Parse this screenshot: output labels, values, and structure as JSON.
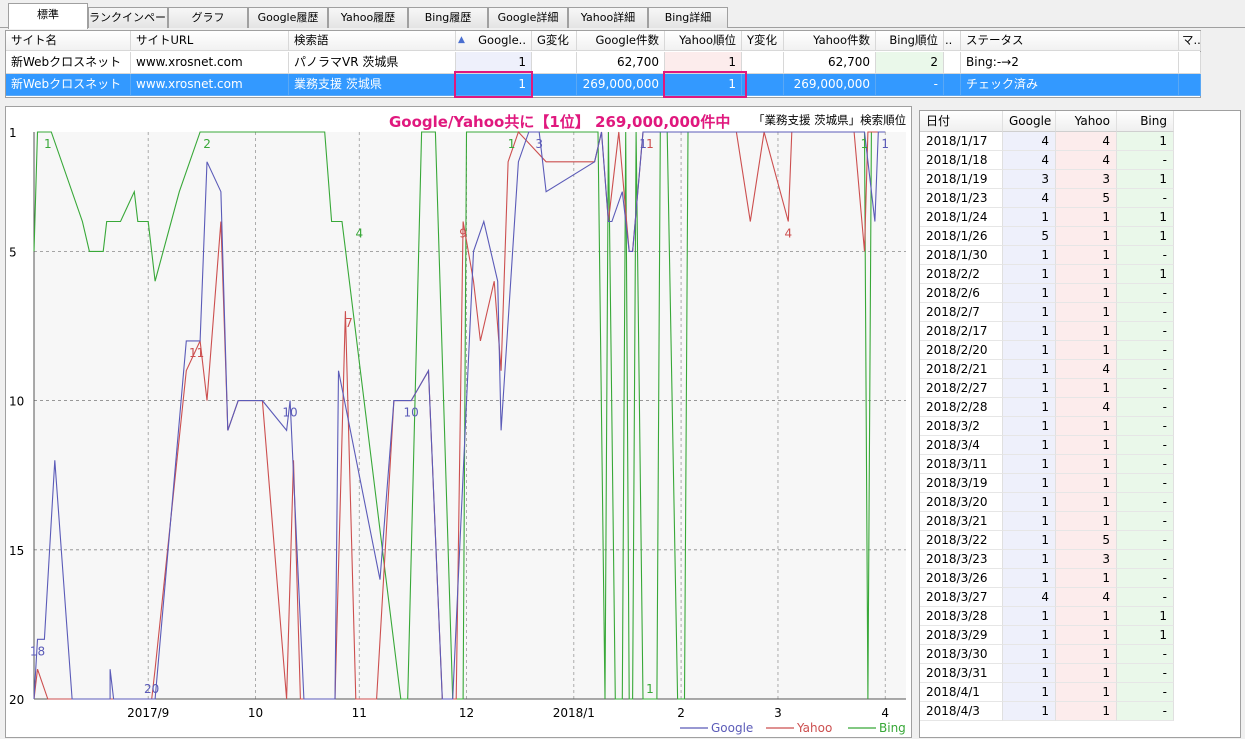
{
  "tabs": [
    "標準",
    "ランクインページ",
    "グラフ",
    "Google履歴",
    "Yahoo履歴",
    "Bing履歴",
    "Google詳細",
    "Yahoo詳細",
    "Bing詳細"
  ],
  "grid": {
    "headers": [
      "サイト名",
      "サイトURL",
      "検索語",
      "Google..",
      "G変化",
      "Google件数",
      "Yahoo順位",
      "Y変化",
      "Yahoo件数",
      "Bing順位",
      "..",
      "ステータス",
      "マ.."
    ],
    "rows": [
      {
        "site": "新Webクロスネット",
        "url": "www.xrosnet.com",
        "keyword": "パノラマVR 茨城県",
        "google": "1",
        "gchange": "",
        "gcount": "62,700",
        "yahoo": "1",
        "ychange": "",
        "ycount": "62,700",
        "bing": "2",
        "x": "",
        "status": "Bing:-→2",
        "m": ""
      },
      {
        "site": "新Webクロスネット",
        "url": "www.xrosnet.com",
        "keyword": "業務支援 茨城県",
        "google": "1",
        "gchange": "",
        "gcount": "269,000,000",
        "yahoo": "1",
        "ychange": "",
        "ycount": "269,000,000",
        "bing": "-",
        "x": "",
        "status": "チェック済み",
        "m": ""
      }
    ]
  },
  "chart": {
    "headline": "Google/Yahoo共に【1位】 269,000,000件中",
    "subtitle": "「業務支援 茨城県」検索順位",
    "headline_color": "#e0187e",
    "colors": {
      "google": "#5b5bb8",
      "yahoo": "#cc4f4f",
      "bing": "#38a838"
    }
  },
  "chart_data": {
    "type": "line",
    "title": "「業務支援 茨城県」検索順位",
    "y_ticks": [
      "1",
      "5",
      "10",
      "15",
      "20"
    ],
    "ylim": [
      20,
      1
    ],
    "y_inverted": true,
    "x_ticks": [
      "2017/9",
      "10",
      "11",
      "12",
      "2018/1",
      "2",
      "3",
      "4"
    ],
    "x_tick_days": [
      33,
      64,
      94,
      125,
      156,
      187,
      215,
      246
    ],
    "xlim": [
      0,
      252
    ],
    "grid": true,
    "legend_position": "bottom-right",
    "legend": [
      "Google",
      "Yahoo",
      "Bing"
    ],
    "series": [
      {
        "name": "Google",
        "points": [
          [
            0,
            20
          ],
          [
            1,
            18
          ],
          [
            3,
            18
          ],
          [
            6,
            12
          ],
          [
            11,
            20
          ],
          [
            22,
            20
          ],
          [
            22,
            19
          ],
          [
            23,
            20
          ],
          [
            34,
            20
          ],
          [
            35,
            20
          ],
          [
            44,
            8
          ],
          [
            48,
            8
          ],
          [
            50,
            2
          ],
          [
            54,
            3
          ],
          [
            56,
            11
          ],
          [
            59,
            10
          ],
          [
            66,
            10
          ],
          [
            73,
            11
          ],
          [
            74,
            10
          ],
          [
            78,
            20
          ],
          [
            87,
            20
          ],
          [
            88,
            9
          ],
          [
            100,
            16
          ],
          [
            104,
            10
          ],
          [
            109,
            10
          ],
          [
            114,
            9
          ],
          [
            118,
            20
          ],
          [
            121,
            20
          ],
          [
            127,
            5
          ],
          [
            130,
            4
          ],
          [
            134,
            6
          ],
          [
            135,
            11
          ],
          [
            140,
            2
          ],
          [
            143,
            1
          ],
          [
            146,
            1
          ],
          [
            148,
            3
          ],
          [
            162,
            2
          ],
          [
            164,
            1
          ],
          [
            166,
            4
          ],
          [
            167,
            4
          ],
          [
            170,
            3
          ],
          [
            172,
            5
          ],
          [
            173,
            5
          ],
          [
            176,
            1
          ],
          [
            180,
            1
          ],
          [
            183,
            1
          ],
          [
            186,
            1
          ],
          [
            194,
            1
          ],
          [
            203,
            1
          ],
          [
            211,
            1
          ],
          [
            219,
            1
          ],
          [
            225,
            1
          ],
          [
            237,
            1
          ],
          [
            240,
            1
          ],
          [
            243,
            4
          ],
          [
            244,
            1
          ],
          [
            246,
            1
          ]
        ],
        "labels": [
          [
            1,
            "18"
          ],
          [
            34,
            "20"
          ],
          [
            74,
            "10"
          ],
          [
            109,
            "10"
          ],
          [
            146,
            "3"
          ],
          [
            176,
            "1"
          ],
          [
            246,
            "1"
          ]
        ]
      },
      {
        "name": "Yahoo",
        "points": [
          [
            0,
            20
          ],
          [
            1,
            19
          ],
          [
            4,
            20
          ],
          [
            9,
            20
          ],
          [
            12,
            20
          ],
          [
            34,
            20
          ],
          [
            35,
            19
          ],
          [
            44,
            9
          ],
          [
            48,
            8
          ],
          [
            50,
            10
          ],
          [
            54,
            4
          ],
          [
            56,
            11
          ],
          [
            59,
            10
          ],
          [
            66,
            10
          ],
          [
            73,
            20
          ],
          [
            75,
            12
          ],
          [
            77,
            20
          ],
          [
            87,
            20
          ],
          [
            90,
            7
          ],
          [
            93,
            20
          ],
          [
            99,
            20
          ],
          [
            104,
            10
          ],
          [
            109,
            10
          ],
          [
            114,
            9
          ],
          [
            118,
            20
          ],
          [
            122,
            20
          ],
          [
            124,
            4
          ],
          [
            127,
            6
          ],
          [
            129,
            8
          ],
          [
            133,
            6
          ],
          [
            135,
            9
          ],
          [
            137,
            2
          ],
          [
            140,
            1
          ],
          [
            148,
            2
          ],
          [
            162,
            2
          ],
          [
            164,
            1
          ],
          [
            166,
            4
          ],
          [
            169,
            1
          ],
          [
            172,
            5
          ],
          [
            173,
            5
          ],
          [
            176,
            1
          ],
          [
            180,
            1
          ],
          [
            183,
            1
          ],
          [
            194,
            1
          ],
          [
            203,
            1
          ],
          [
            207,
            4
          ],
          [
            211,
            1
          ],
          [
            218,
            4
          ],
          [
            219,
            1
          ],
          [
            225,
            1
          ],
          [
            237,
            1
          ],
          [
            240,
            5
          ],
          [
            241,
            1
          ],
          [
            243,
            1
          ],
          [
            246,
            1
          ]
        ],
        "labels": [
          [
            47,
            "11"
          ],
          [
            91,
            "7"
          ],
          [
            124,
            "9"
          ],
          [
            178,
            "1"
          ],
          [
            218,
            "4"
          ]
        ]
      },
      {
        "name": "Bing",
        "points": [
          [
            0,
            5
          ],
          [
            1,
            1
          ],
          [
            5,
            1
          ],
          [
            14,
            4
          ],
          [
            16,
            5
          ],
          [
            20,
            5
          ],
          [
            21,
            4
          ],
          [
            25,
            4
          ],
          [
            29,
            3
          ],
          [
            30,
            4
          ],
          [
            33,
            4
          ],
          [
            35,
            6
          ],
          [
            42,
            3
          ],
          [
            48,
            1
          ],
          [
            50,
            1
          ],
          [
            53,
            1
          ],
          [
            84,
            1
          ],
          [
            86,
            4
          ],
          [
            89,
            4
          ],
          [
            106,
            20
          ],
          [
            108,
            20
          ],
          [
            112,
            1
          ],
          [
            116,
            1
          ],
          [
            121,
            20
          ],
          [
            124,
            20
          ],
          [
            125,
            1
          ],
          [
            129,
            1
          ],
          [
            141,
            1
          ],
          [
            148,
            1
          ],
          [
            163,
            1
          ],
          [
            165,
            20
          ],
          [
            166,
            1
          ],
          [
            168,
            20
          ],
          [
            170,
            20
          ],
          [
            171,
            1
          ],
          [
            172,
            20
          ],
          [
            173,
            20
          ],
          [
            174,
            1
          ],
          [
            176,
            20
          ],
          [
            180,
            20
          ],
          [
            181,
            1
          ],
          [
            183,
            1
          ],
          [
            186,
            20
          ],
          [
            188,
            20
          ],
          [
            189,
            1
          ],
          [
            193,
            1
          ],
          [
            219,
            1
          ],
          [
            236,
            1
          ],
          [
            240,
            1
          ],
          [
            241,
            20
          ],
          [
            242,
            1
          ],
          [
            246,
            1
          ]
        ],
        "labels": [
          [
            4,
            "1"
          ],
          [
            50,
            "2"
          ],
          [
            94,
            "4"
          ],
          [
            138,
            "1"
          ],
          [
            178,
            "1"
          ],
          [
            240,
            "1"
          ]
        ]
      }
    ]
  },
  "history": {
    "headers": [
      "日付",
      "Google",
      "Yahoo",
      "Bing"
    ],
    "rows": [
      [
        "2018/1/17",
        "4",
        "4",
        "1"
      ],
      [
        "2018/1/18",
        "4",
        "4",
        "-"
      ],
      [
        "2018/1/19",
        "3",
        "3",
        "1"
      ],
      [
        "2018/1/23",
        "4",
        "5",
        "-"
      ],
      [
        "2018/1/24",
        "1",
        "1",
        "1"
      ],
      [
        "2018/1/26",
        "5",
        "1",
        "1"
      ],
      [
        "2018/1/30",
        "1",
        "1",
        "-"
      ],
      [
        "2018/2/2",
        "1",
        "1",
        "1"
      ],
      [
        "2018/2/6",
        "1",
        "1",
        "-"
      ],
      [
        "2018/2/7",
        "1",
        "1",
        "-"
      ],
      [
        "2018/2/17",
        "1",
        "1",
        "-"
      ],
      [
        "2018/2/20",
        "1",
        "1",
        "-"
      ],
      [
        "2018/2/21",
        "1",
        "4",
        "-"
      ],
      [
        "2018/2/27",
        "1",
        "1",
        "-"
      ],
      [
        "2018/2/28",
        "1",
        "4",
        "-"
      ],
      [
        "2018/3/2",
        "1",
        "1",
        "-"
      ],
      [
        "2018/3/4",
        "1",
        "1",
        "-"
      ],
      [
        "2018/3/11",
        "1",
        "1",
        "-"
      ],
      [
        "2018/3/19",
        "1",
        "1",
        "-"
      ],
      [
        "2018/3/20",
        "1",
        "1",
        "-"
      ],
      [
        "2018/3/21",
        "1",
        "1",
        "-"
      ],
      [
        "2018/3/22",
        "1",
        "5",
        "-"
      ],
      [
        "2018/3/23",
        "1",
        "3",
        "-"
      ],
      [
        "2018/3/26",
        "1",
        "1",
        "-"
      ],
      [
        "2018/3/27",
        "4",
        "4",
        "-"
      ],
      [
        "2018/3/28",
        "1",
        "1",
        "1"
      ],
      [
        "2018/3/29",
        "1",
        "1",
        "1"
      ],
      [
        "2018/3/30",
        "1",
        "1",
        "-"
      ],
      [
        "2018/3/31",
        "1",
        "1",
        "-"
      ],
      [
        "2018/4/1",
        "1",
        "1",
        "-"
      ],
      [
        "2018/4/3",
        "1",
        "1",
        "-"
      ]
    ]
  }
}
